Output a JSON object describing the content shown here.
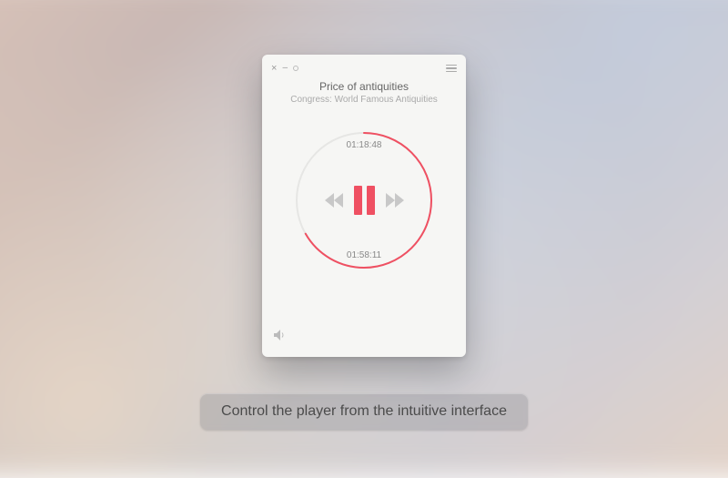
{
  "caption": "Control the player from the intuitive interface",
  "track": {
    "title": "Price of antiquities",
    "subtitle": "Congress: World Famous Antiquities"
  },
  "time": {
    "elapsed": "01:18:48",
    "total": "01:58:11"
  },
  "progress": {
    "fraction": 0.667
  },
  "colors": {
    "accent": "#ef5062",
    "ring_bg": "#e6e6e4"
  }
}
